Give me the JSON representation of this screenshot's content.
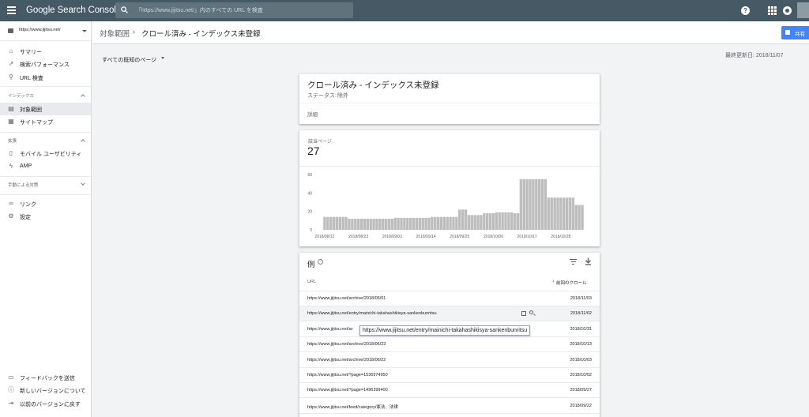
{
  "app": {
    "logo": "Google Search Console"
  },
  "search": {
    "placeholder": "「https://www.jijitsu.net/」内のすべての URL を検査"
  },
  "property": {
    "label": "https://www.jijitsu.net/"
  },
  "sidebar": {
    "top_items": [
      {
        "label": "サマリー",
        "icon": "home-icon"
      },
      {
        "label": "検索パフォーマンス",
        "icon": "trending-up-icon"
      },
      {
        "label": "URL 検査",
        "icon": "search-icon"
      }
    ],
    "sections": [
      {
        "title": "インデックス",
        "items": [
          {
            "label": "対象範囲",
            "icon": "coverage-icon",
            "active": true
          },
          {
            "label": "サイトマップ",
            "icon": "sitemap-icon"
          }
        ]
      },
      {
        "title": "拡張",
        "items": [
          {
            "label": "モバイル ユーザビリティ",
            "icon": "mobile-icon"
          },
          {
            "label": "AMP",
            "icon": "amp-icon"
          }
        ]
      },
      {
        "title": "手動による対策",
        "items": []
      }
    ],
    "misc_items": [
      {
        "label": "リンク",
        "icon": "link-icon"
      },
      {
        "label": "設定",
        "icon": "gear-icon"
      }
    ],
    "bottom_items": [
      {
        "label": "フィードバックを送信",
        "icon": "feedback-icon"
      },
      {
        "label": "新しいバージョンについて",
        "icon": "info-icon"
      },
      {
        "label": "以前のバージョンに戻す",
        "icon": "exit-icon"
      }
    ]
  },
  "header": {
    "breadcrumb_parent": "対象範囲",
    "breadcrumb_current": "クロール済み - インデックス未登録",
    "share_label": "共有"
  },
  "filter": {
    "label": "すべての既知のページ"
  },
  "updated": {
    "label": "最終更新日:",
    "date": "2018/11/07"
  },
  "status_card": {
    "title": "クロール済み - インデックス未登録",
    "status_label": "ステータス:",
    "status_value": "除外",
    "details_label": "詳細"
  },
  "pages_card": {
    "label": "該当ページ",
    "value": "27"
  },
  "chart_data": {
    "type": "bar",
    "y_ticks": [
      0,
      20,
      40,
      60
    ],
    "ylim": [
      0,
      60
    ],
    "grid": false,
    "legend": "none",
    "bar_color": "#bdbdbd",
    "x_tick_labels": [
      "2018/08/12",
      "2018/08/23",
      "2018/09/03",
      "2018/09/14",
      "2018/09/25",
      "2018/10/06",
      "2018/10/17",
      "2018/10/28"
    ],
    "dates": [
      "2018/08/12",
      "2018/08/13",
      "2018/08/14",
      "2018/08/15",
      "2018/08/16",
      "2018/08/17",
      "2018/08/18",
      "2018/08/19",
      "2018/08/20",
      "2018/08/21",
      "2018/08/22",
      "2018/08/23",
      "2018/08/24",
      "2018/08/25",
      "2018/08/26",
      "2018/08/27",
      "2018/08/28",
      "2018/08/29",
      "2018/08/30",
      "2018/08/31",
      "2018/09/01",
      "2018/09/02",
      "2018/09/03",
      "2018/09/04",
      "2018/09/05",
      "2018/09/06",
      "2018/09/07",
      "2018/09/08",
      "2018/09/09",
      "2018/09/10",
      "2018/09/11",
      "2018/09/12",
      "2018/09/13",
      "2018/09/14",
      "2018/09/15",
      "2018/09/16",
      "2018/09/17",
      "2018/09/18",
      "2018/09/19",
      "2018/09/20",
      "2018/09/21",
      "2018/09/22",
      "2018/09/23",
      "2018/09/24",
      "2018/09/25",
      "2018/09/26",
      "2018/09/27",
      "2018/09/28",
      "2018/09/29",
      "2018/09/30",
      "2018/10/01",
      "2018/10/02",
      "2018/10/03",
      "2018/10/04",
      "2018/10/05",
      "2018/10/06",
      "2018/10/07",
      "2018/10/08",
      "2018/10/09",
      "2018/10/10",
      "2018/10/11",
      "2018/10/12",
      "2018/10/13",
      "2018/10/14",
      "2018/10/15",
      "2018/10/16",
      "2018/10/17",
      "2018/10/18",
      "2018/10/19",
      "2018/10/20",
      "2018/10/21",
      "2018/10/22",
      "2018/10/23",
      "2018/10/24",
      "2018/10/25",
      "2018/10/26",
      "2018/10/27",
      "2018/10/28",
      "2018/10/29",
      "2018/10/30",
      "2018/10/31",
      "2018/11/01",
      "2018/11/02",
      "2018/11/03",
      "2018/11/04"
    ],
    "values": [
      14,
      14,
      14,
      14,
      14,
      14,
      14,
      14,
      12,
      12,
      12,
      12,
      12,
      12,
      12,
      12,
      12,
      12,
      12,
      12,
      12,
      12,
      12,
      13,
      13,
      13,
      13,
      13,
      13,
      13,
      13,
      13,
      13,
      13,
      13,
      14,
      14,
      14,
      14,
      14,
      14,
      14,
      14,
      14,
      22,
      22,
      22,
      16,
      16,
      16,
      16,
      16,
      18,
      18,
      18,
      18,
      19,
      19,
      19,
      19,
      19,
      19,
      18,
      18,
      55,
      55,
      55,
      55,
      55,
      55,
      55,
      55,
      55,
      35,
      35,
      35,
      35,
      35,
      35,
      35,
      35,
      35,
      27,
      27,
      27
    ]
  },
  "examples_card": {
    "title": "例",
    "col_url": "URL",
    "col_crawl": "前回のクロール",
    "rows": [
      {
        "url": "https://www.jijitsu.net/archive/2018/05/01",
        "date": "2018/11/03"
      },
      {
        "url": "https://www.jijitsu.net/entry/mainichi-takahashikisya-sankenbunritsu",
        "date": "2018/11/02"
      },
      {
        "url": "https://www.jijitsu.net/ar",
        "date": "2018/10/31"
      },
      {
        "url": "https://www.jijitsu.net/archive/2018/06/23",
        "date": "2018/10/13"
      },
      {
        "url": "https://www.jijitsu.net/archive/2018/06/22",
        "date": "2018/10/03"
      },
      {
        "url": "https://www.jijitsu.net/?page=1536974950",
        "date": "2018/10/02"
      },
      {
        "url": "https://www.jijitsu.net/?page=1496399400",
        "date": "2018/09/27"
      },
      {
        "url": "https://www.jijitsu.net/feed/category/憲法、法律",
        "date": "2018/09/22"
      }
    ],
    "tooltip": "https://www.jijitsu.net/entry/mainichi-takahashikisya-sankenbunritsu"
  }
}
